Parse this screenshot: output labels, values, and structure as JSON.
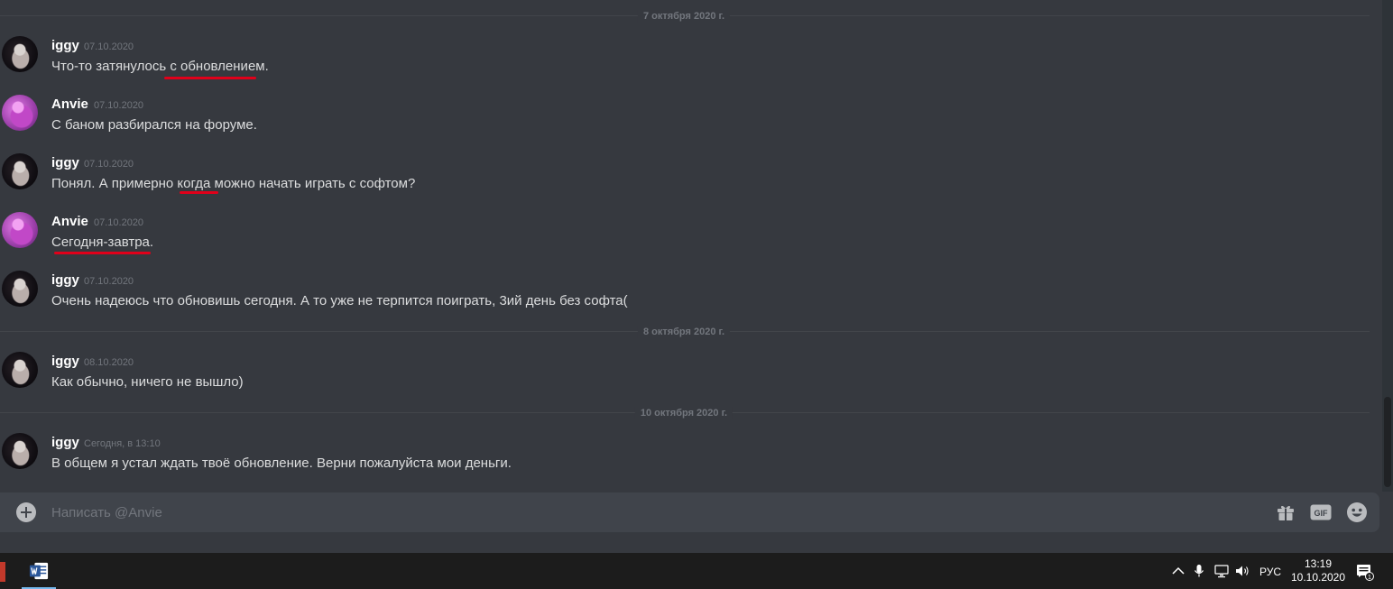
{
  "composer": {
    "placeholder": "Написать @Anvie"
  },
  "dividers": [
    {
      "label": "7 октября 2020 г."
    },
    {
      "label": "8 октября 2020 г."
    },
    {
      "label": "10 октября 2020 г."
    }
  ],
  "messages": [
    {
      "author": "iggy",
      "timestamp": "07.10.2020",
      "text": "Что-то затянулось с обновлением."
    },
    {
      "author": "Anvie",
      "timestamp": "07.10.2020",
      "text": "С баном разбирался на форуме."
    },
    {
      "author": "iggy",
      "timestamp": "07.10.2020",
      "text": "Понял. А примерно когда можно начать играть с софтом?"
    },
    {
      "author": "Anvie",
      "timestamp": "07.10.2020",
      "text": "Сегодня-завтра."
    },
    {
      "author": "iggy",
      "timestamp": "07.10.2020",
      "text": "Очень надеюсь что обновишь сегодня. А то уже не терпится поиграть, 3ий день без софта("
    },
    {
      "author": "iggy",
      "timestamp": "08.10.2020",
      "text": "Как обычно, ничего не вышло)"
    },
    {
      "author": "iggy",
      "timestamp": "Сегодня, в 13:10",
      "text": "В общем я устал ждать твоё обновление. Верни пожалуйста мои деньги."
    }
  ],
  "annotations": {
    "color": "#e0001a",
    "underlined_phrases": [
      "обновлением",
      "когда",
      "Сегодня-завтра"
    ]
  },
  "icons": {
    "composer": [
      "plus-circle-icon",
      "gift-icon",
      "gif-icon",
      "emoji-icon"
    ],
    "taskbar": [
      "word-icon",
      "chevron-up-icon",
      "microphone-icon",
      "network-icon",
      "volume-icon",
      "notification-icon"
    ]
  },
  "taskbar": {
    "language": "РУС",
    "time": "13:19",
    "date": "10.10.2020",
    "notifications_count": "1"
  },
  "colors": {
    "chat_background": "#36393f",
    "input_background": "#40444b",
    "author": "#ffffff",
    "text": "#dcddde",
    "muted": "#72767d"
  }
}
